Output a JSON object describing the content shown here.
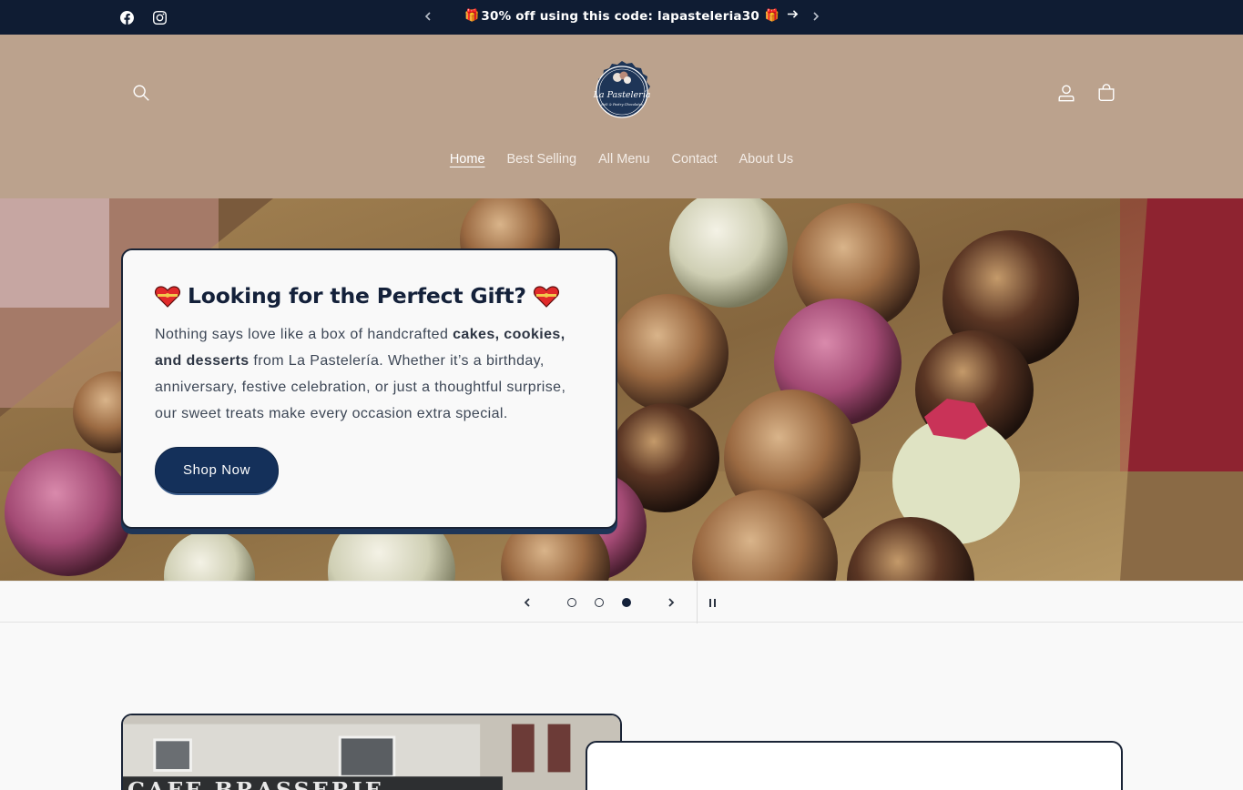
{
  "announcement": {
    "message": "30% off using this code: lapasteleria30",
    "gift_emoji": "🎁",
    "social": [
      "facebook-icon",
      "instagram-icon"
    ]
  },
  "header": {
    "logo_text": "La Pastelería",
    "logo_subtext": "Deli & Pastry Chocolates",
    "nav": [
      {
        "label": "Home",
        "active": true
      },
      {
        "label": "Best Selling",
        "active": false
      },
      {
        "label": "All Menu",
        "active": false
      },
      {
        "label": "Contact",
        "active": false
      },
      {
        "label": "About Us",
        "active": false
      }
    ]
  },
  "hero": {
    "title": "Looking for the Perfect Gift?",
    "text_1": "Nothing says love like a box of handcrafted ",
    "text_bold_1": "cakes, cookies, and desserts",
    "text_2": " from La Pastelería. Whether it’s a birthday, anniversary, festive celebration, or just a thoughtful surprise, our sweet treats make every occasion extra special.",
    "button_label": "Shop Now"
  },
  "slider": {
    "total_slides": 3,
    "current_slide": 3
  },
  "colors": {
    "announcement_bg": "#0f1c33",
    "header_bg": "#bba28d",
    "button_bg": "#14305a",
    "page_bg": "#f9f9f9"
  }
}
